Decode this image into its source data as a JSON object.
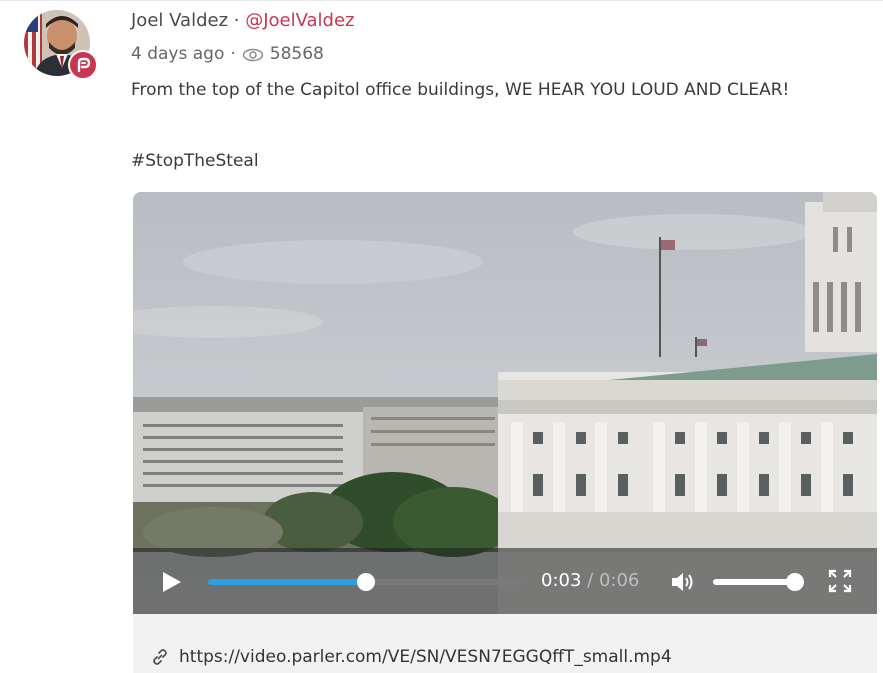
{
  "post": {
    "author_name": "Joel Valdez",
    "separator": " · ",
    "handle": "@JoelValdez",
    "time_ago": "4 days ago",
    "meta_separator": "·",
    "view_count": "58568",
    "body": "From the top of the Capitol office buildings, WE HEAR YOU LOUD AND CLEAR!",
    "hashtag": "#StopTheSteal",
    "badge_icon": "parler-icon",
    "views_icon": "eye-icon"
  },
  "video": {
    "current_time": "0:03",
    "time_separator": " / ",
    "duration": "0:06",
    "progress_fraction": 0.5,
    "volume_fraction": 1.0,
    "controls": {
      "play_icon": "play-icon",
      "volume_icon": "volume-icon",
      "fullscreen_icon": "fullscreen-icon"
    }
  },
  "link": {
    "icon": "link-icon",
    "url": "https://video.parler.com/VE/SN/VESN7EGGQffT_small.mp4"
  },
  "colors": {
    "accent": "#c8364f",
    "progress": "#2ba0e0"
  }
}
